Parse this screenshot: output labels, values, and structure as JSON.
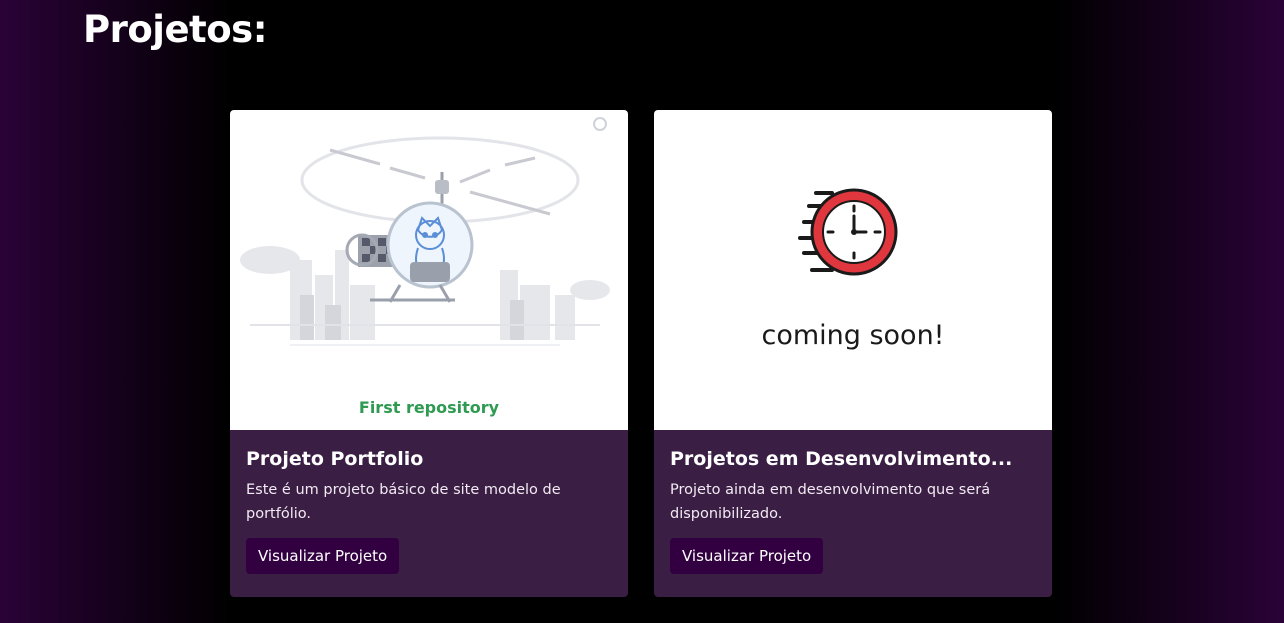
{
  "page": {
    "title": "Projetos:"
  },
  "projects": [
    {
      "image_caption": "First repository",
      "title": "Projeto Portfolio",
      "description": "Este é um projeto básico de site modelo de portfólio.",
      "button_label": "Visualizar Projeto",
      "image_icon": "helicopter-octocat-illustration"
    },
    {
      "image_caption": "coming soon!",
      "title": "Projetos em Desenvolvimento...",
      "description": "Projeto ainda em desenvolvimento que será disponibilizado.",
      "button_label": "Visualizar Projeto",
      "image_icon": "clock-icon"
    }
  ],
  "colors": {
    "background_edge": "#2a0237",
    "card_body": "#3a1e43",
    "button": "#320041",
    "caption_green": "#2f9a52",
    "clock_red": "#e0373f"
  }
}
